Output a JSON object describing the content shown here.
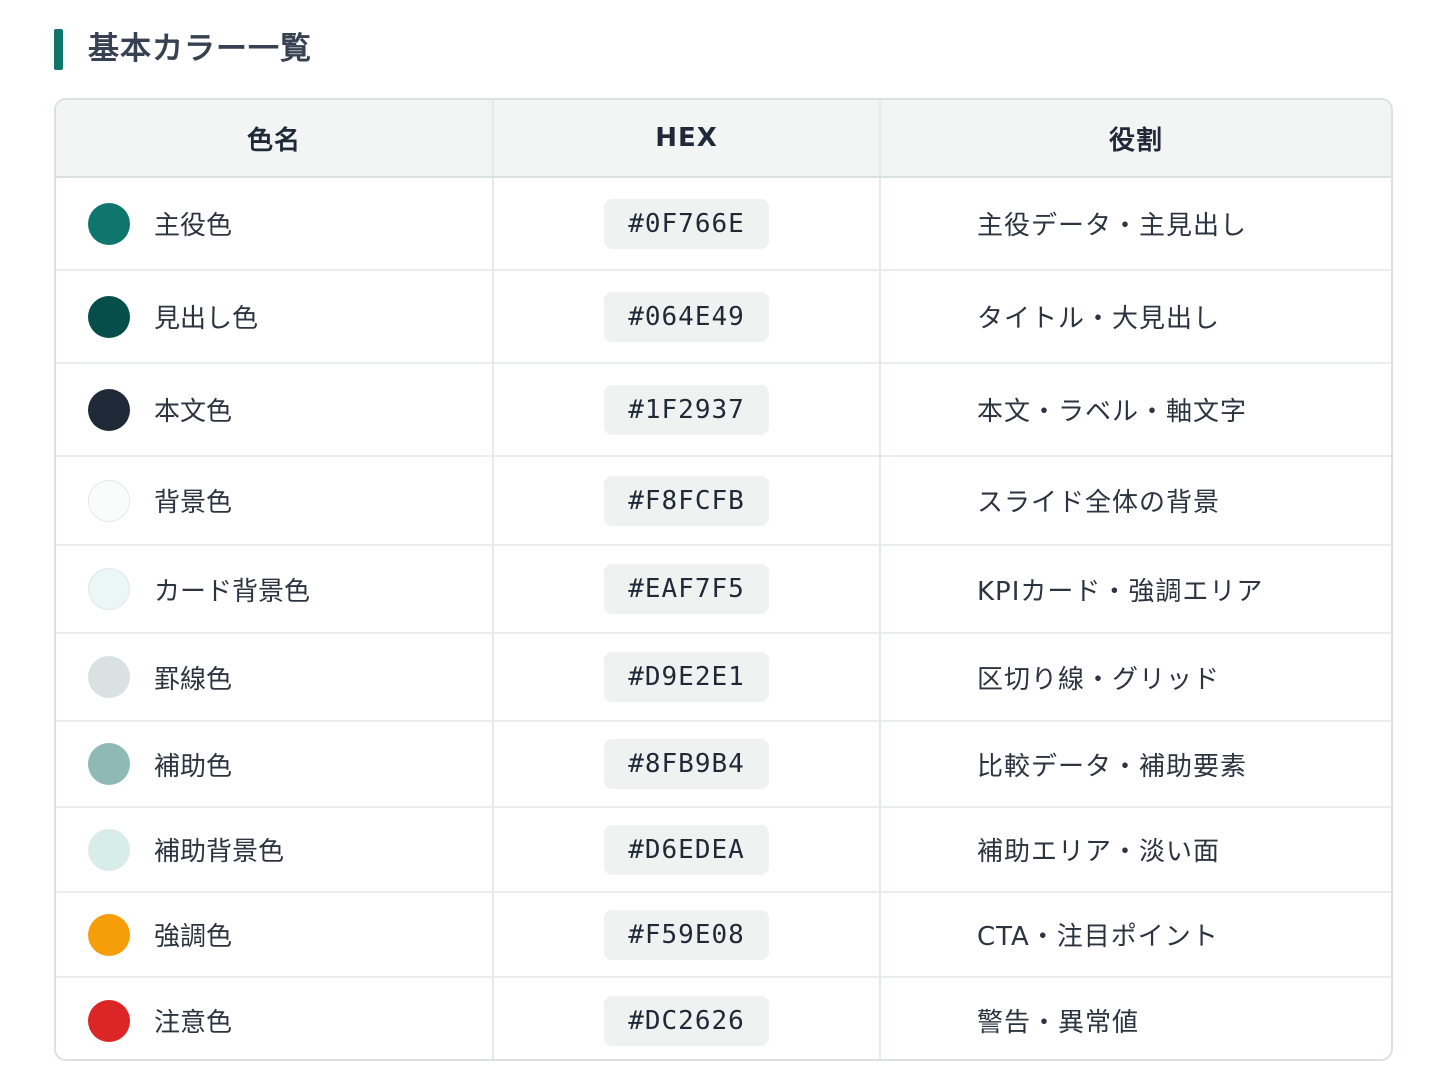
{
  "page": {
    "title": "基本カラー一覧"
  },
  "table": {
    "headers": [
      "色名",
      "HEX",
      "役割"
    ],
    "rows": [
      {
        "name": "主役色",
        "hex": "#0F766E",
        "role": "主役データ・主見出し",
        "color": "#0F766E"
      },
      {
        "name": "見出し色",
        "hex": "#064E49",
        "role": "タイトル・大見出し",
        "color": "#064E49"
      },
      {
        "name": "本文色",
        "hex": "#1F2937",
        "role": "本文・ラベル・軸文字",
        "color": "#1F2937"
      },
      {
        "name": "背景色",
        "hex": "#F8FCFB",
        "role": "スライド全体の背景",
        "color": "#F8FCFB"
      },
      {
        "name": "カード背景色",
        "hex": "#EAF7F5",
        "role": "KPIカード・強調エリア",
        "color": "#EAF7F5"
      },
      {
        "name": "罫線色",
        "hex": "#D9E2E1",
        "role": "区切り線・グリッド",
        "color": "#D9E2E1"
      },
      {
        "name": "補助色",
        "hex": "#8FB9B4",
        "role": "比較データ・補助要素",
        "color": "#8FB9B4"
      },
      {
        "name": "補助背景色",
        "hex": "#D6EDEA",
        "role": "補助エリア・淡い面",
        "color": "#D6EDEA"
      },
      {
        "name": "強調色",
        "hex": "#F59E08",
        "role": "CTA・注目ポイント",
        "color": "#F59E08"
      },
      {
        "name": "注意色",
        "hex": "#DC2626",
        "role": "警告・異常値",
        "color": "#DC2626"
      }
    ]
  }
}
